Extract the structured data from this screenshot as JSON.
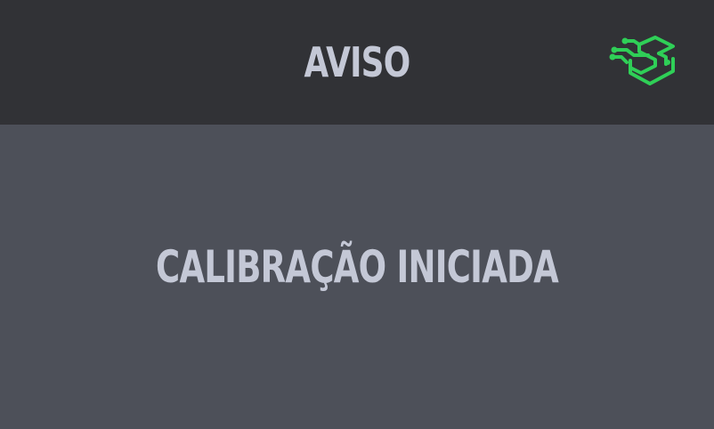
{
  "header": {
    "title": "AVISO",
    "logo_icon": "circuit-box-logo-icon",
    "background": "#313236"
  },
  "body": {
    "message": "CALIBRAÇÃO INICIADA",
    "background": "#4d5059"
  },
  "colors": {
    "text": "#c4c8d6",
    "logo_green": "#2fcf57"
  }
}
